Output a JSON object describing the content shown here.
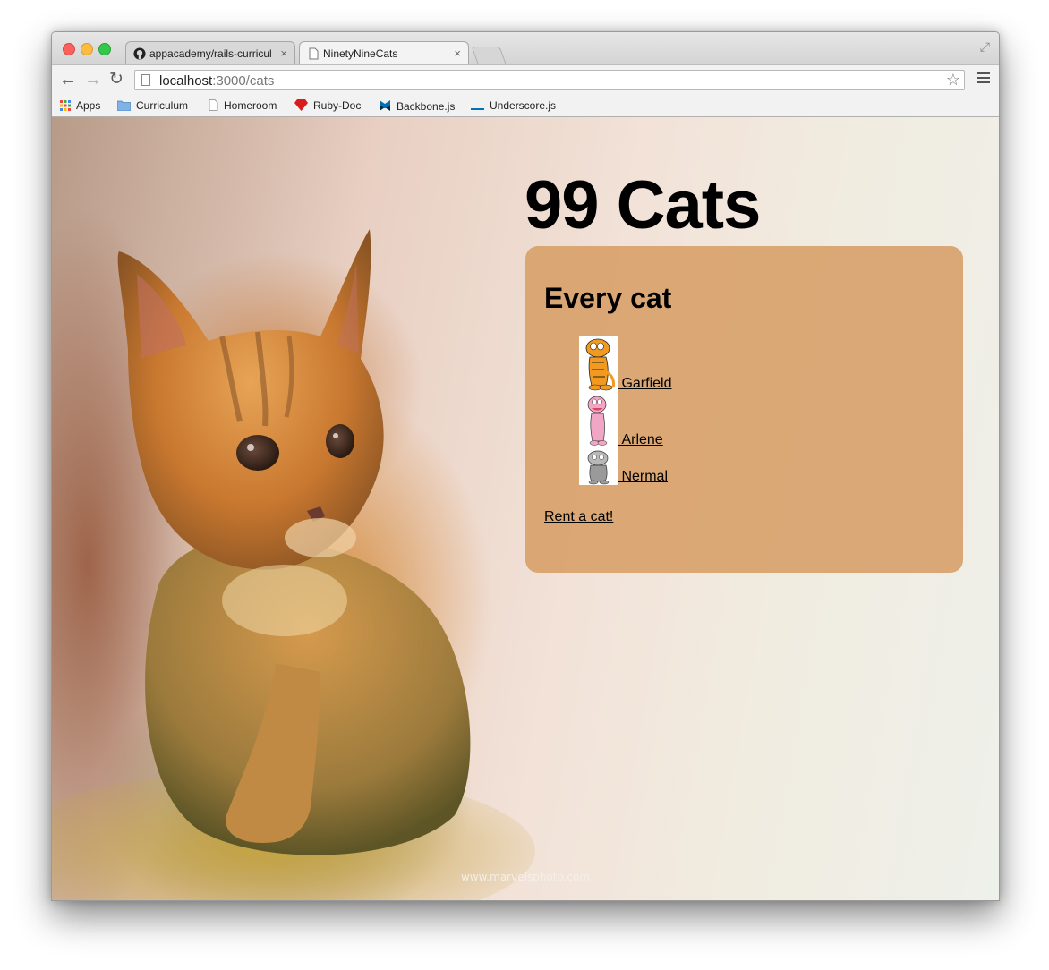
{
  "browser": {
    "tabs": [
      {
        "title": "appacademy/rails-curricul",
        "active": false,
        "icon": "github-icon"
      },
      {
        "title": "NinetyNineCats",
        "active": true,
        "icon": "page-icon"
      }
    ],
    "address": {
      "host": "localhost",
      "path": ":3000/cats"
    },
    "bookmarks": [
      {
        "label": "Apps",
        "icon": "apps-grid-icon"
      },
      {
        "label": "Curriculum",
        "icon": "folder-icon"
      },
      {
        "label": "Homeroom",
        "icon": "page-icon"
      },
      {
        "label": "Ruby-Doc",
        "icon": "ruby-icon"
      },
      {
        "label": "Backbone.js",
        "icon": "backbone-icon"
      },
      {
        "label": "Underscore.js",
        "icon": "underscore-icon"
      }
    ]
  },
  "page": {
    "title": "99 Cats",
    "panel_title": "Every cat",
    "cats": [
      {
        "name": "Garfield",
        "thumb_color": "#f29a1f"
      },
      {
        "name": "Arlene",
        "thumb_color": "#f2a6c6"
      },
      {
        "name": "Nermal",
        "thumb_color": "#9a9a9a"
      }
    ],
    "rent_link": "Rent a cat!",
    "watermark": "www.marvelsphoto.com"
  },
  "colors": {
    "panel": "#d9a56f",
    "link": "#000000"
  }
}
